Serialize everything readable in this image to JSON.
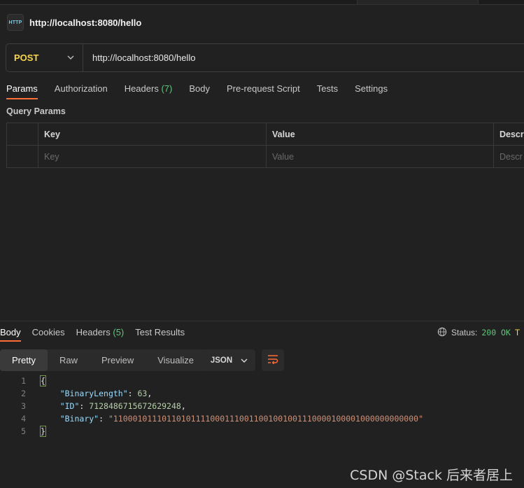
{
  "request": {
    "title": "http://localhost:8080/hello",
    "method": "POST",
    "url": "http://localhost:8080/hello",
    "tabs": [
      {
        "label": "Params"
      },
      {
        "label": "Authorization"
      },
      {
        "label": "Headers",
        "count": "(7)"
      },
      {
        "label": "Body"
      },
      {
        "label": "Pre-request Script"
      },
      {
        "label": "Tests"
      },
      {
        "label": "Settings"
      }
    ],
    "query_params_label": "Query Params",
    "table": {
      "headers": [
        "Key",
        "Value",
        "Descr"
      ],
      "placeholders": [
        "Key",
        "Value",
        "Descr"
      ]
    }
  },
  "response": {
    "tabs": [
      {
        "label": "Body"
      },
      {
        "label": "Cookies"
      },
      {
        "label": "Headers",
        "count": "(5)"
      },
      {
        "label": "Test Results"
      }
    ],
    "status_label": "Status:",
    "status_value": "200 OK",
    "time_cut": "T",
    "views": [
      "Pretty",
      "Raw",
      "Preview",
      "Visualize"
    ],
    "format": "JSON",
    "code": {
      "line_numbers": [
        "1",
        "2",
        "3",
        "4",
        "5"
      ],
      "open_brace": "{",
      "close_brace": "}",
      "k1": "\"BinaryLength\"",
      "v1": "63",
      "k2": "\"ID\"",
      "v2": "7128486715672629248",
      "k3": "\"Binary\"",
      "v3": "\"110001011101101011110001110011001001001110000100001000000000000\""
    }
  },
  "watermark": "CSDN @Stack 后来者居上",
  "colors": {
    "accent": "#ff6c37",
    "method": "#f8d64e",
    "status_ok": "#5fc77a"
  }
}
